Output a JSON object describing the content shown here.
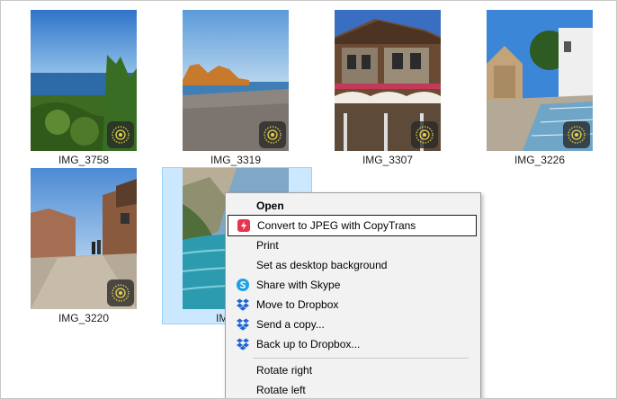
{
  "files": [
    {
      "name": "IMG_3758"
    },
    {
      "name": "IMG_3319"
    },
    {
      "name": "IMG_3307"
    },
    {
      "name": "IMG_3226"
    },
    {
      "name": "IMG_3220"
    },
    {
      "name": "IMG_"
    }
  ],
  "context_menu": {
    "items": [
      {
        "label": "Open",
        "icon": ""
      },
      {
        "label": "Convert to JPEG with CopyTrans",
        "icon": "copytrans-icon"
      },
      {
        "label": "Print",
        "icon": ""
      },
      {
        "label": "Set as desktop background",
        "icon": ""
      },
      {
        "label": "Share with Skype",
        "icon": "skype-icon"
      },
      {
        "label": "Move to Dropbox",
        "icon": "dropbox-icon"
      },
      {
        "label": "Send a copy...",
        "icon": "dropbox-icon"
      },
      {
        "label": "Back up to Dropbox...",
        "icon": "dropbox-icon"
      },
      {
        "label": "Rotate right",
        "icon": ""
      },
      {
        "label": "Rotate left",
        "icon": ""
      }
    ]
  },
  "colors": {
    "selection_bg": "#cce8ff",
    "selection_border": "#99d1ff",
    "menu_bg": "#f2f2f2",
    "copytrans_red": "#e8344e",
    "skype_blue": "#1aa1e6",
    "dropbox_blue": "#1f66d4"
  }
}
